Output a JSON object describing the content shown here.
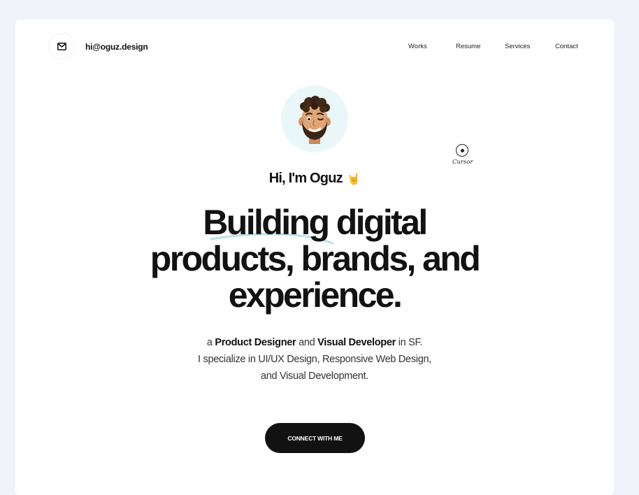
{
  "header": {
    "email": "hi@oguz.design",
    "nav": [
      {
        "label": "Works"
      },
      {
        "label": "Resume"
      },
      {
        "label": "Services"
      },
      {
        "label": "Contact"
      }
    ]
  },
  "hero": {
    "greeting": "Hi, I'm Oguz",
    "greeting_emoji": "🤘",
    "headline_line1": "Building digital",
    "headline_line2": "products, brands, and",
    "headline_line3": "experience.",
    "intro_a": "a",
    "intro_role1": "Product Designer",
    "intro_and": "and",
    "intro_role2": "Visual Developer",
    "intro_location": "in SF.",
    "intro_line2": "I specialize in UI/UX Design, Responsive Web Design,",
    "intro_line3": "and Visual Development.",
    "cta_label": "CONNECT WITH ME"
  },
  "cursor": {
    "label": "Cursor"
  },
  "icons": {
    "mail": "mail-icon",
    "avatar": "memoji-avatar",
    "cursor": "cursor-icon"
  },
  "colors": {
    "page_bg": "#f1f3fb",
    "card_bg": "#ffffff",
    "avatar_bg": "#e9f7f9",
    "cta_bg": "#121212",
    "underline": "#b9e3ea"
  }
}
